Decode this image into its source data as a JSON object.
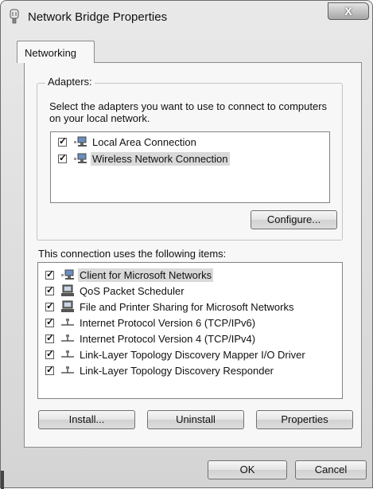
{
  "window": {
    "title": "Network Bridge Properties",
    "close_label": "X"
  },
  "tabs": [
    {
      "label": "Networking"
    }
  ],
  "adapters": {
    "group_label": "Adapters:",
    "instruction": "Select the adapters you want to use to connect to computers on your local network.",
    "items": [
      {
        "label": "Local Area Connection",
        "checked": true
      },
      {
        "label": "Wireless Network Connection",
        "checked": true,
        "selected": true
      }
    ],
    "configure_label": "Configure..."
  },
  "components": {
    "heading": "This connection uses the following items:",
    "items": [
      {
        "label": "Client for Microsoft Networks",
        "icon": "network-client-icon",
        "checked": true,
        "selected": true
      },
      {
        "label": "QoS Packet Scheduler",
        "icon": "service-icon",
        "checked": true
      },
      {
        "label": "File and Printer Sharing for Microsoft Networks",
        "icon": "service-icon",
        "checked": true
      },
      {
        "label": "Internet Protocol Version 6 (TCP/IPv6)",
        "icon": "protocol-icon",
        "checked": true
      },
      {
        "label": "Internet Protocol Version 4 (TCP/IPv4)",
        "icon": "protocol-icon",
        "checked": true
      },
      {
        "label": "Link-Layer Topology Discovery Mapper I/O Driver",
        "icon": "protocol-icon",
        "checked": true
      },
      {
        "label": "Link-Layer Topology Discovery Responder",
        "icon": "protocol-icon",
        "checked": true
      }
    ],
    "install_label": "Install...",
    "uninstall_label": "Uninstall",
    "properties_label": "Properties"
  },
  "footer": {
    "ok_label": "OK",
    "cancel_label": "Cancel"
  }
}
